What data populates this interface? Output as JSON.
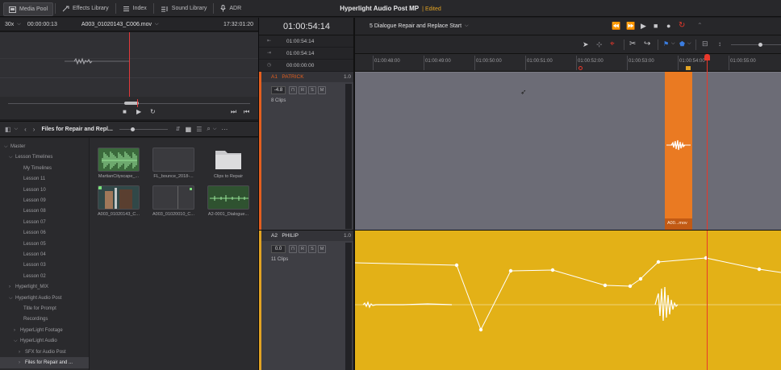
{
  "topbar": {
    "items": [
      {
        "label": "Media Pool",
        "icon": "media-pool-icon"
      },
      {
        "label": "Effects Library",
        "icon": "effects-icon"
      },
      {
        "label": "Index",
        "icon": "index-icon"
      },
      {
        "label": "Sound Library",
        "icon": "sound-library-icon"
      },
      {
        "label": "ADR",
        "icon": "microphone-icon"
      }
    ],
    "project_title": "Hyperlight Audio Post MP",
    "edited_label": "Edited"
  },
  "source": {
    "zoom": "30x",
    "timecode": "00:00:00:13",
    "clip_name": "A003_01020143_C006.mov",
    "duration": "17:32:01:20"
  },
  "bin": {
    "name": "Files for Repair and Repl..."
  },
  "tree": [
    {
      "label": "Master",
      "level": 0,
      "arrow": "v"
    },
    {
      "label": "Lesson Timelines",
      "level": 1,
      "arrow": "v"
    },
    {
      "label": "My Timelines",
      "level": 2
    },
    {
      "label": "Lesson 11",
      "level": 2
    },
    {
      "label": "Lesson 10",
      "level": 2
    },
    {
      "label": "Lesson 09",
      "level": 2
    },
    {
      "label": "Lesson 08",
      "level": 2
    },
    {
      "label": "Lesson 07",
      "level": 2
    },
    {
      "label": "Lesson 06",
      "level": 2
    },
    {
      "label": "Lesson 05",
      "level": 2
    },
    {
      "label": "Lesson 04",
      "level": 2
    },
    {
      "label": "Lesson 03",
      "level": 2
    },
    {
      "label": "Lesson 02",
      "level": 2
    },
    {
      "label": "Hyperlight_MIX",
      "level": 1,
      "arrow": ">"
    },
    {
      "label": "Hyperlight Audio Post",
      "level": 1,
      "arrow": "v"
    },
    {
      "label": "Title for Prompt",
      "level": 2
    },
    {
      "label": "Recordings",
      "level": 2
    },
    {
      "label": "HyperLight Footage",
      "level": 2,
      "arrow": ">"
    },
    {
      "label": "HyperLight Audio",
      "level": 2,
      "arrow": "v"
    },
    {
      "label": "SFX for Audio Post",
      "level": 3,
      "arrow": ">"
    },
    {
      "label": "Files for Repair and ...",
      "level": 3,
      "arrow": ">",
      "selected": true
    }
  ],
  "thumbs": [
    {
      "label": "MartianCityscape_...",
      "kind": "audio-green"
    },
    {
      "label": "FL_bounce_2018-...",
      "kind": "blank"
    },
    {
      "label": "Clips to Repair",
      "kind": "folder"
    },
    {
      "label": "A003_01020143_C...",
      "kind": "video"
    },
    {
      "label": "A003_01020010_C...",
      "kind": "blank2"
    },
    {
      "label": "A2-0001_Dialogue...",
      "kind": "audio-line"
    }
  ],
  "timeline": {
    "timecode": "01:00:54:14",
    "rows": [
      {
        "icon": "⇤",
        "value": "01:00:54:14"
      },
      {
        "icon": "⇥",
        "value": "01:00:54:14"
      },
      {
        "icon": "◷",
        "value": "00:00:00:00"
      }
    ],
    "name": "5 Dialogue Repair and Replace Start",
    "ruler": [
      "01:00:48:00",
      "01:00:49:00",
      "01:00:50:00",
      "01:00:51:00",
      "01:00:52:00",
      "01:00:53:00",
      "01:00:54:00",
      "01:00:55:00"
    ],
    "tracks": [
      {
        "id": "A1",
        "name": "PATRICK",
        "level": "1.0",
        "volume": "-4.8",
        "clips": "8 Clips",
        "color": "#e45f1f",
        "clip_label": "A00...mov"
      },
      {
        "id": "A2",
        "name": "PHILIP",
        "level": "1.0",
        "volume": "0.0",
        "clips": "11 Clips",
        "color": "#e2a323"
      }
    ],
    "buttons": {
      "R": "R",
      "S": "S",
      "M": "M"
    }
  },
  "colors": {
    "accent_orange": "#e45f1f",
    "accent_yellow": "#e2a323",
    "playhead": "#e8382b"
  }
}
